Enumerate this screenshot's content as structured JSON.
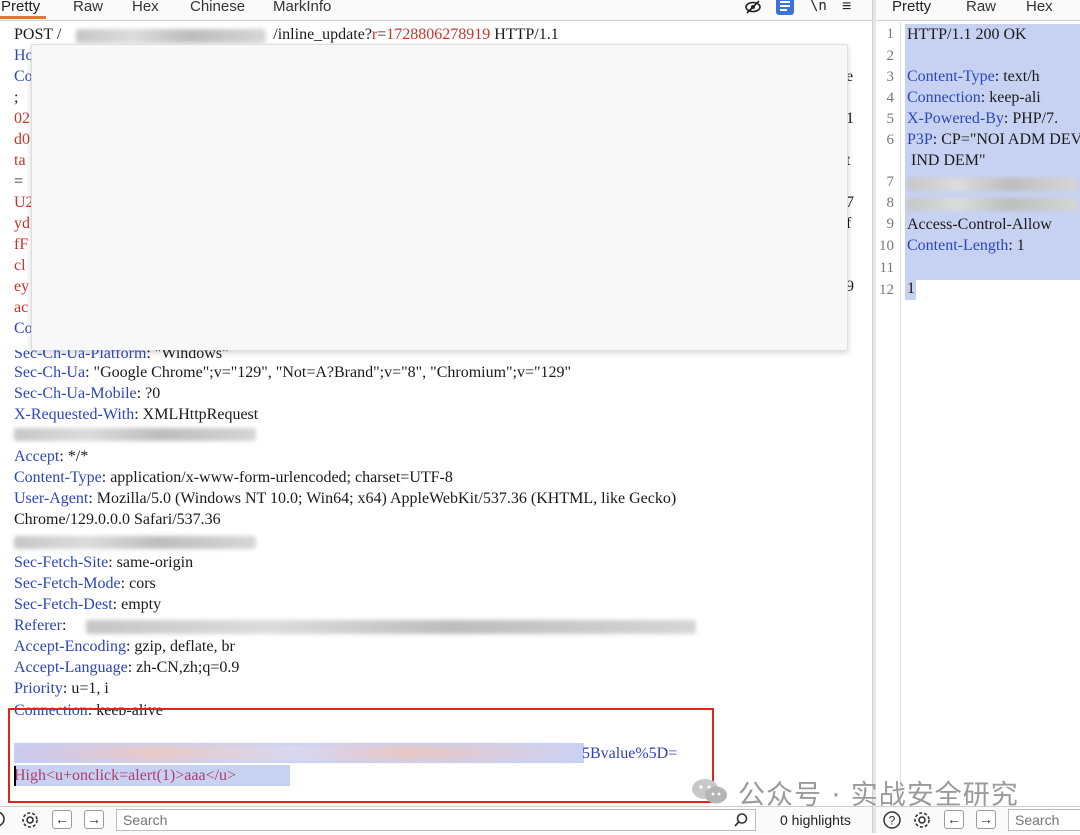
{
  "request_editor": {
    "tabs": [
      "Pretty",
      "Raw",
      "Hex",
      "Chinese",
      "MarkInfo"
    ],
    "toolbar": {
      "newline_label": "\\n",
      "menu_glyph": "≡"
    },
    "lines": {
      "l1_pre": "POST /",
      "l1_mid": "/inline_update?",
      "l1_param": "r",
      "l1_eq": "=",
      "l1_val": "1728806278919",
      "l1_post": " HTTP/1.1",
      "l2": "Ho",
      "l3": "Co",
      "l4": ";",
      "l5": "02",
      "l6": "d0",
      "l7": "ta",
      "l8": "=",
      "l9": "U2",
      "l10": "yd",
      "l11": "fF",
      "l12": "cl",
      "l13": "ey",
      "l14": "ac",
      "l15": "Co",
      "platform_key": "Sec-Ch-Ua-Platform",
      "platform_val": ": \"Windows\"",
      "ua_key": "Sec-Ch-Ua",
      "ua_val": ": \"Google Chrome\";v=\"129\", \"Not=A?Brand\";v=\"8\", \"Chromium\";v=\"129\"",
      "mobile_key": "Sec-Ch-Ua-Mobile",
      "mobile_val": ": ?0",
      "xrw_key": "X-Requested-With",
      "xrw_val": ": XMLHttpRequest",
      "accept_key": "Accept",
      "accept_val": ": */*",
      "ct_key": "Content-Type",
      "ct_val": ": application/x-www-form-urlencoded; charset=UTF-8",
      "useragent_key": "User-Agent",
      "useragent_val": ": Mozilla/5.0 (Windows NT 10.0; Win64; x64) AppleWebKit/537.36 (KHTML, like Gecko)",
      "useragent_cont": "Chrome/129.0.0.0 Safari/537.36",
      "sfs_key": "Sec-Fetch-Site",
      "sfs_val": ": same-origin",
      "sfm_key": "Sec-Fetch-Mode",
      "sfm_val": ": cors",
      "sfd_key": "Sec-Fetch-Dest",
      "sfd_val": ": empty",
      "referer_key": "Referer",
      "referer_val": ":",
      "ae_key": "Accept-Encoding",
      "ae_val": ": gzip, deflate, br",
      "al_key": "Accept-Language",
      "al_val": ": zh-CN,zh;q=0.9",
      "priority_key": "Priority",
      "priority_val": ": u=1, i",
      "connection_key": "Connection",
      "connection_val": ": keep-alive",
      "body_tail": "5Bvalue%5D=",
      "body_payload": "High<u+onclick=alert(1)>aaa</u>"
    },
    "edge_chars": {
      "r4": "e",
      "r6": "1",
      "r8": "t",
      "r10": "7",
      "r11": "f",
      "r14": "9"
    },
    "bottom": {
      "search_placeholder": "Search",
      "highlights": "0 highlights"
    }
  },
  "response_viewer": {
    "tabs": [
      "Pretty",
      "Raw",
      "Hex"
    ],
    "line_numbers": [
      "1",
      "2",
      "3",
      "4",
      "5",
      "6",
      "7",
      "8",
      "9",
      "10",
      "11",
      "12"
    ],
    "lines": {
      "l1": "HTTP/1.1 200 OK",
      "l3_key": "Content-Type",
      "l3_val": ": text/h",
      "l4_key": "Connection",
      "l4_val": ": keep-ali",
      "l5_key": "X-Powered-By",
      "l5_val": ": PHP/7.",
      "l6_key": "P3P",
      "l6_val": ": CP=\"NOI ADM DEV",
      "l6_cont": " IND DEM\"",
      "l9_key": "Access-Control-Allow",
      "l10_key": "Content-Length",
      "l10_val": ": 1",
      "l12": "1"
    },
    "bottom": {
      "search_placeholder": "Search"
    }
  },
  "watermark": {
    "icon": "wechat-icon",
    "text": "公众号 · 实战安全研究"
  },
  "colors": {
    "header_key": "#2c46b8",
    "param_red": "#c8342b",
    "selection": "#c7d2f3",
    "active_tab_underline": "#e8762b",
    "highlight_box": "#e3221e",
    "wrap_button": "#3d73d9"
  }
}
